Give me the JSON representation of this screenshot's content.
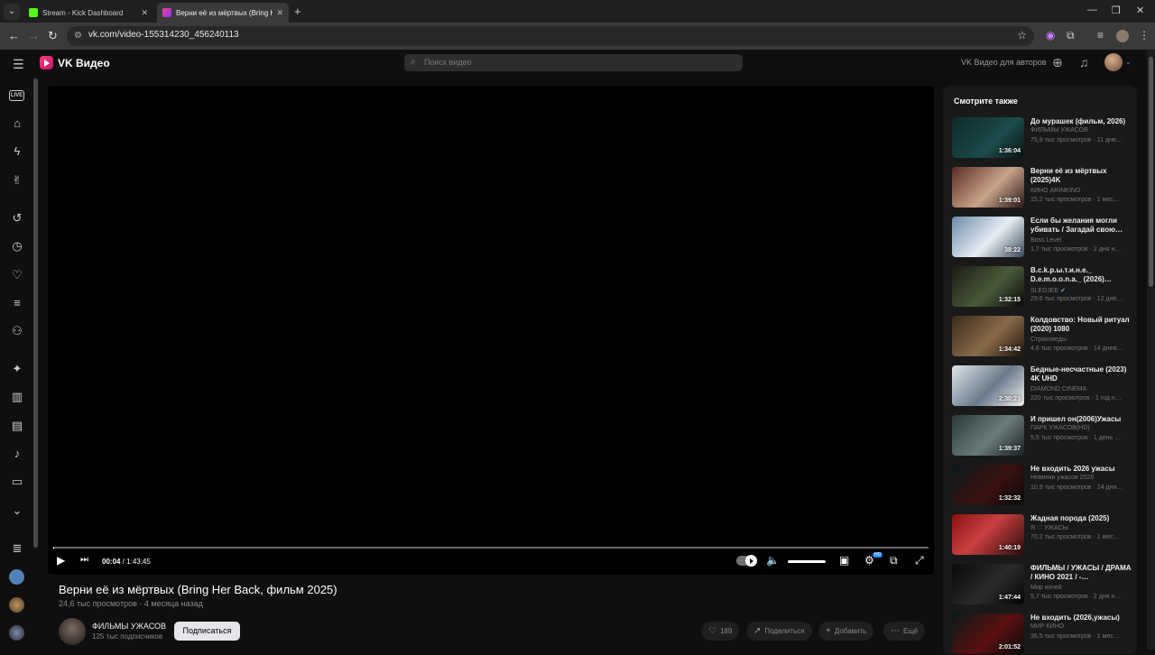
{
  "browser": {
    "tabs": [
      {
        "title": "Stream - Kick Dashboard",
        "active": false
      },
      {
        "title": "Верни её из мёртвых (Bring H",
        "active": true
      }
    ],
    "url": "vk.com/video-155314230_456240113"
  },
  "header": {
    "brand": "VK Видео",
    "search_placeholder": "Поиск видео",
    "authors_link": "VK Видео для авторов"
  },
  "player": {
    "current_time": "00:04",
    "separator": " / ",
    "duration": "1:43:45",
    "progress_fraction": 0.001,
    "volume_fraction": 1.0,
    "quality_badge": "HD"
  },
  "video": {
    "title": "Верни её из мёртвых (Bring Her Back, фильм 2025)",
    "views": "24,6 тыс просмотров",
    "age": "4 месяца назад",
    "channel_name": "ФИЛЬМЫ УЖАСОВ",
    "channel_subs": "125 тыс подписчиков",
    "subscribe_label": "Подписаться",
    "likes": "189",
    "share_label": "Поделиться",
    "add_label": "Добавить",
    "more_label": "Ещё"
  },
  "sidebar_title": "Смотрите также",
  "recommendations": [
    {
      "title": "До мурашек (фильм, 2026)",
      "channel": "ФИЛЬМЫ УЖАСОВ",
      "meta": "75,9 тыс просмотров · 11 дне…",
      "duration": "1:36:04",
      "verified": false
    },
    {
      "title": "Верни её из мёртвых (2025)4K",
      "channel": "КИНО ARINKINO",
      "meta": "15,2 тыс просмотров · 1 мес…",
      "duration": "1:39:01",
      "verified": false
    },
    {
      "title": "Если бы желания могли убивать / Загадай свою…",
      "channel": "Boss Level",
      "meta": "1,7 тыс просмотров · 2 дня н…",
      "duration": "38:22",
      "verified": false
    },
    {
      "title": "В.с.k.р.ы.т.и.н.е._ D.e.m.o.o.n.a._ (2026)…",
      "channel": "SLEDJEE",
      "meta": "29,6 тыс просмотров · 12 дне…",
      "duration": "1:32:15",
      "verified": true
    },
    {
      "title": "Колдовство: Новый ритуал (2020) 1080",
      "channel": "Страховеды",
      "meta": "4,6 тыс просмотров · 14 дней…",
      "duration": "1:34:42",
      "verified": false
    },
    {
      "title": "Бедные-несчастные (2023) 4K UHD",
      "channel": "DIAMOND CINEMA",
      "meta": "220 тыс просмотров · 1 год н…",
      "duration": "2:30:23",
      "verified": false
    },
    {
      "title": "И пришел он(2006)Ужасы",
      "channel": "ПАРК УЖАСОВ(HD)",
      "meta": "5,5 тыс просмотров · 1 день …",
      "duration": "1:39:37",
      "verified": false
    },
    {
      "title": "Не входить 2026 ужасы",
      "channel": "Новинки ужасов 2026",
      "meta": "10,9 тыс просмотров · 24 дня…",
      "duration": "1:32:32",
      "verified": false
    },
    {
      "title": "Жадная порода (2025)",
      "channel": "Я ♡ УЖАСЫ",
      "meta": "70,2 тыс просмотров · 1 мес…",
      "duration": "1:40:19",
      "verified": false
    },
    {
      "title": "ФИЛЬМЫ / УЖАСЫ / ДРАМА / КИНО 2021 / -…",
      "channel": "Мир ночей",
      "meta": "5,7 тыс просмотров · 2 дня н…",
      "duration": "1:47:44",
      "verified": false
    },
    {
      "title": "Не входить (2026,ужасы)",
      "channel": "МИР КИНО",
      "meta": "36,5 тыс просмотров · 1 мес…",
      "duration": "2:01:52",
      "verified": false
    }
  ]
}
